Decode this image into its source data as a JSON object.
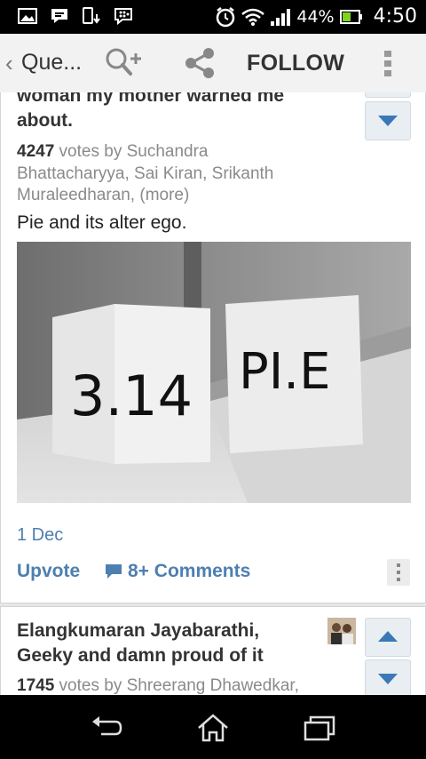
{
  "status_bar": {
    "battery_percent": "44%",
    "time": "4:50",
    "icons": [
      "gallery-icon",
      "chat-icon",
      "phone-download-icon",
      "bbm-icon",
      "alarm-icon",
      "wifi-icon",
      "signal-icon",
      "battery-icon"
    ]
  },
  "action_bar": {
    "back_glyph": "‹",
    "title": "Que...",
    "follow_label": "FOLLOW",
    "icons": [
      "add-user-icon",
      "share-icon",
      "overflow-menu-icon"
    ]
  },
  "answer1": {
    "author_line1": "woman my mother warned me",
    "author_line2": "about.",
    "votes_count": "4247",
    "votes_text": " votes by Suchandra",
    "votes_line2": "Bhattacharyya, Sai Kiran, Srikanth",
    "votes_line3": "Muraleedharan, (more)",
    "text": "Pie and its alter ego.",
    "photo_text_left": "3.14",
    "photo_text_right": "PI.E",
    "date": "1 Dec",
    "upvote_label": "Upvote",
    "comments_label": "8+ Comments"
  },
  "answer2": {
    "author_line1": "Elangkumaran Jayabarathi,",
    "author_line2": "Geeky and damn proud of it",
    "votes_count": "1745",
    "votes_text": " votes by Shreerang Dhawedkar,"
  },
  "colors": {
    "accent": "#4d7fb1",
    "vote_button_bg": "#e9eef3",
    "status_bar_bg": "#000000"
  }
}
